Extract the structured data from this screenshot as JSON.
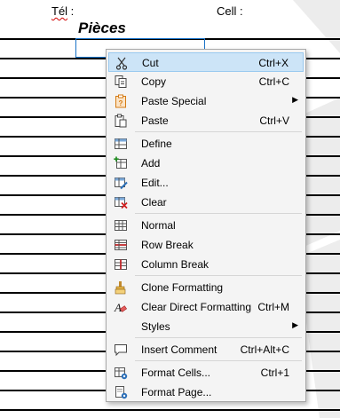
{
  "document": {
    "tel_label": "Tél",
    "tel_suffix": " :",
    "cell_label": "Cell :",
    "heading": "Pièces"
  },
  "context_menu": {
    "items": [
      {
        "label": "Cut",
        "mnemonic": "C",
        "shortcut": "Ctrl+X",
        "icon": "scissors-icon",
        "highlighted": true
      },
      {
        "label": "Copy",
        "shortcut": "Ctrl+C",
        "icon": "copy-icon"
      },
      {
        "label": "Paste Special",
        "icon": "paste-special-icon",
        "submenu": true
      },
      {
        "label": "Paste",
        "shortcut": "Ctrl+V",
        "icon": "paste-icon"
      },
      {
        "label": "Define",
        "icon": "define-icon"
      },
      {
        "label": "Add",
        "icon": "add-icon"
      },
      {
        "label": "Edit...",
        "icon": "edit-icon"
      },
      {
        "label": "Clear",
        "icon": "clear-icon"
      },
      {
        "label": "Normal",
        "icon": "normal-view-icon"
      },
      {
        "label": "Row Break",
        "icon": "row-break-icon"
      },
      {
        "label": "Column Break",
        "icon": "column-break-icon"
      },
      {
        "label": "Clone Formatting",
        "icon": "clone-formatting-icon"
      },
      {
        "label": "Clear Direct Formatting",
        "shortcut": "Ctrl+M",
        "icon": "clear-direct-formatting-icon"
      },
      {
        "label": "Styles",
        "submenu": true
      },
      {
        "label": "Insert Comment",
        "shortcut": "Ctrl+Alt+C",
        "icon": "insert-comment-icon"
      },
      {
        "label": "Format Cells...",
        "shortcut": "Ctrl+1",
        "icon": "format-cells-icon"
      },
      {
        "label": "Format Page...",
        "icon": "format-page-icon"
      }
    ],
    "submenu_arrow": "▶"
  },
  "colors": {
    "highlight_bg": "#cce4f7",
    "highlight_border": "#99c9ef",
    "menu_bg": "#f4f4f4",
    "selection_border": "#1a73c8"
  }
}
